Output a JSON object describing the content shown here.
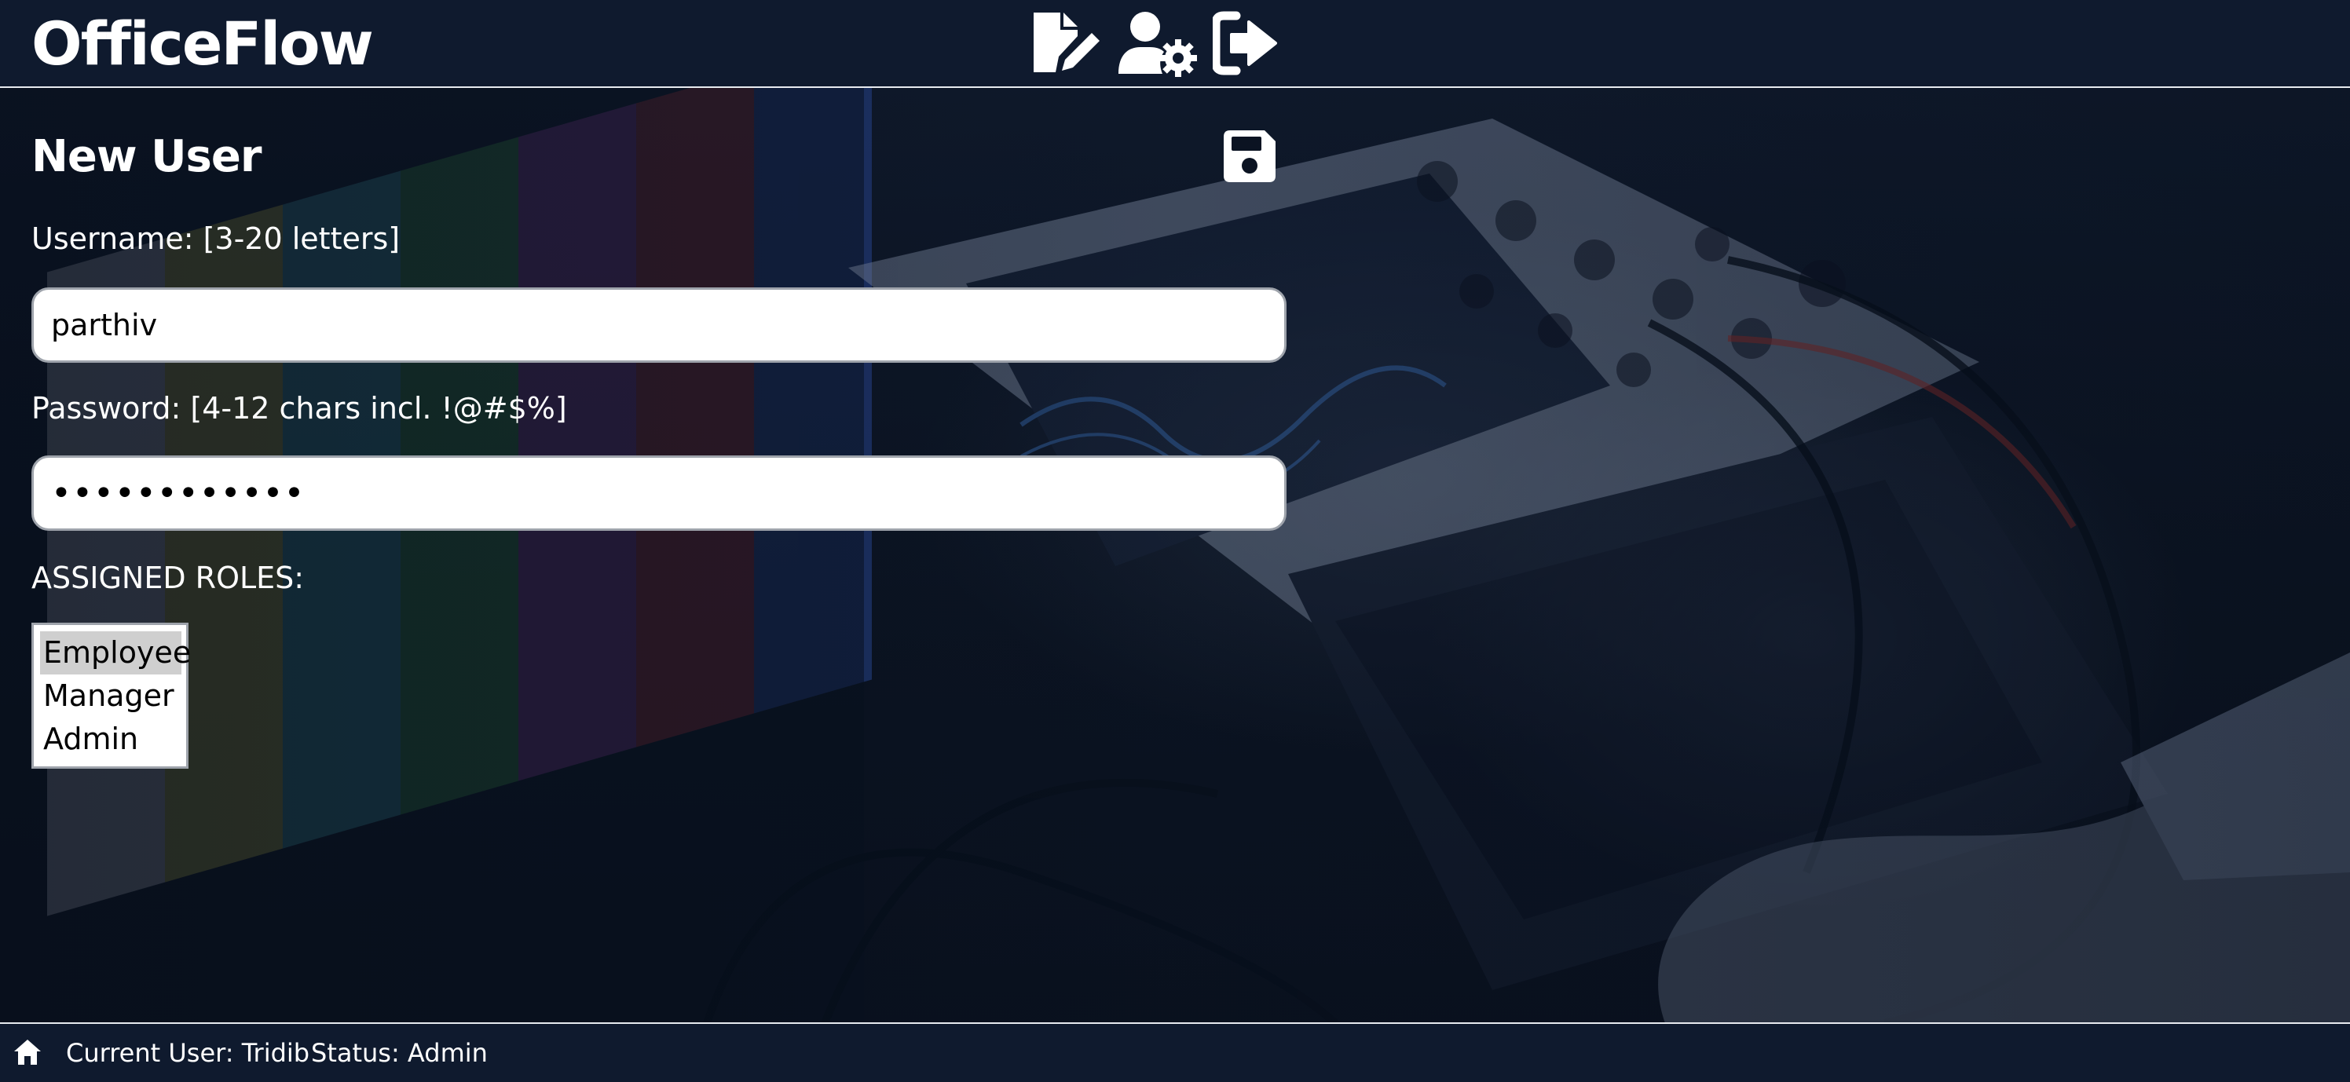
{
  "app": {
    "title": "OfficeFlow"
  },
  "header": {
    "icons": [
      "file-edit-icon",
      "user-settings-icon",
      "logout-icon"
    ]
  },
  "form": {
    "title": "New User",
    "save_icon": "save-icon",
    "username": {
      "label": "Username: [3-20 letters]",
      "value": "parthiv"
    },
    "password": {
      "label": "Password: [4-12 chars incl. !@#$%]",
      "value": "••••••••••••"
    },
    "roles": {
      "label": "ASSIGNED ROLES:",
      "options": [
        "Employee",
        "Manager",
        "Admin"
      ],
      "selected": "Employee"
    }
  },
  "footer": {
    "home_icon": "home-icon",
    "current_user": "Current User: Tridib",
    "status": "Status: Admin"
  },
  "colors": {
    "header_bg": "#0f1a2e",
    "page_bg": "#0b1322",
    "text": "#ffffff",
    "input_bg": "#ffffff",
    "selected_option_bg": "#cfcfcf"
  }
}
